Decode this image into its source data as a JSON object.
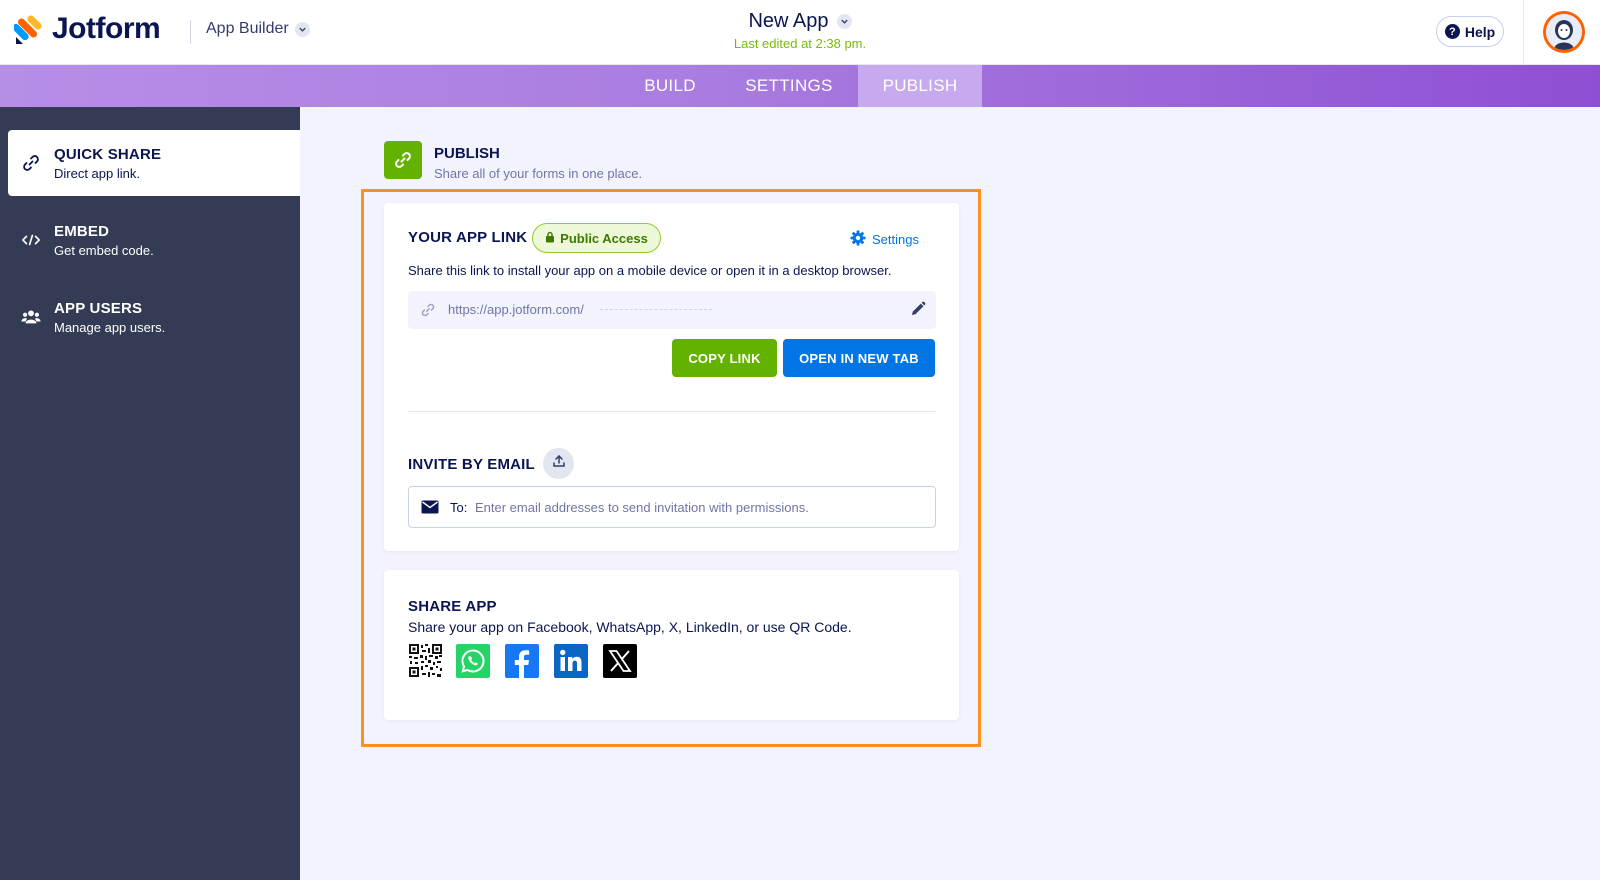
{
  "header": {
    "logo_text": "Jotform",
    "product": "App Builder",
    "app_title": "New App",
    "last_edited": "Last edited at 2:38 pm.",
    "help_label": "Help"
  },
  "tabs": [
    {
      "label": "BUILD"
    },
    {
      "label": "SETTINGS"
    },
    {
      "label": "PUBLISH",
      "active": true
    }
  ],
  "sidebar": {
    "items": [
      {
        "title": "QUICK SHARE",
        "subtitle": "Direct app link.",
        "icon": "link-icon",
        "active": true
      },
      {
        "title": "EMBED",
        "subtitle": "Get embed code.",
        "icon": "code-icon"
      },
      {
        "title": "APP USERS",
        "subtitle": "Manage app users.",
        "icon": "users-icon"
      }
    ]
  },
  "publish": {
    "title": "PUBLISH",
    "subtitle": "Share all of your forms in one place."
  },
  "app_link": {
    "label": "YOUR APP LINK",
    "badge": "Public Access",
    "settings_label": "Settings",
    "description": "Share this link to install your app on a mobile device or open it in a desktop browser.",
    "url": "https://app.jotform.com/",
    "copy_label": "COPY LINK",
    "open_label": "OPEN IN NEW TAB"
  },
  "invite": {
    "label": "INVITE BY EMAIL",
    "to_label": "To:",
    "placeholder": "Enter email addresses to send invitation with permissions."
  },
  "share_app": {
    "label": "SHARE APP",
    "description": "Share your app on Facebook, WhatsApp, X, LinkedIn, or use QR Code.",
    "platforms": [
      "qr-code",
      "whatsapp",
      "facebook",
      "linkedin",
      "x"
    ]
  },
  "colors": {
    "accent_green": "#64b200",
    "accent_blue": "#0075e3",
    "highlight_orange": "#ff8f1f",
    "sidebar_bg": "#343c55",
    "navy": "#0a1551"
  }
}
